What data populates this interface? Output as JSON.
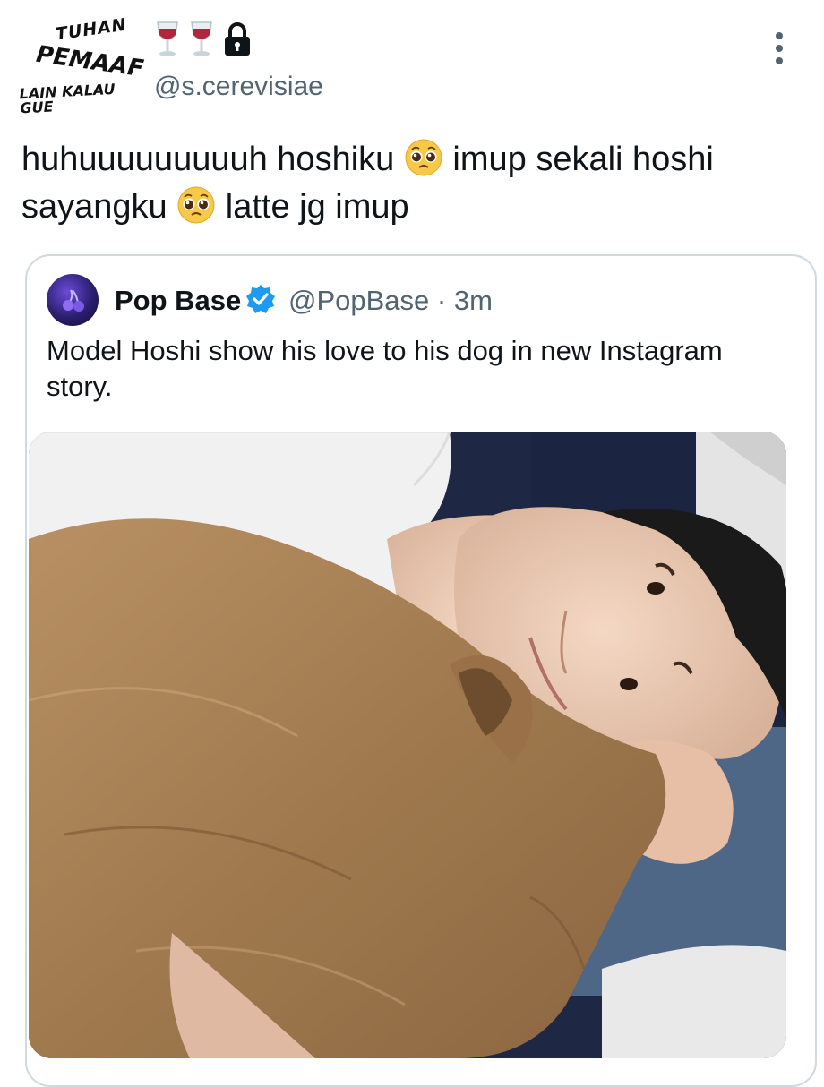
{
  "author": {
    "avatar_logo_lines": [
      "TUHAN",
      "PEMAAF",
      "LAIN KALAU GUE"
    ],
    "handle": "@s.cerevisiae",
    "name_emojis": [
      "wine-glass",
      "wine-glass",
      "lock"
    ]
  },
  "tweet": {
    "text_part1": "huhuuuuuuuuuh hoshiku ",
    "text_part2": " imup sekali hoshi sayangku ",
    "text_part3": " latte jg imup",
    "emoji": "pleading-face"
  },
  "quoted": {
    "name": "Pop Base",
    "handle_time": "@PopBase · 3m",
    "verified": true,
    "text": "Model Hoshi show his love to his dog in new Instagram story.",
    "media": "photo of a man lying next to a tan dog"
  },
  "colors": {
    "text": "#0f1419",
    "secondary": "#536471",
    "border": "#cfd9de",
    "verified": "#1d9bf0"
  }
}
